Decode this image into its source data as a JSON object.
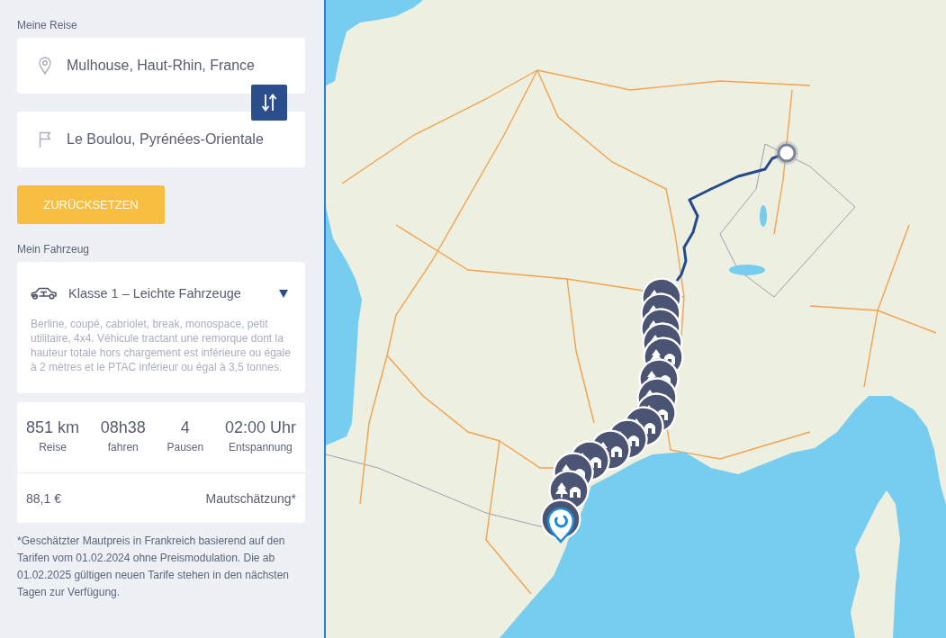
{
  "trip": {
    "heading": "Meine Reise",
    "origin": {
      "value": "Mulhouse, Haut-Rhin, France"
    },
    "destination": {
      "value": "Le Boulou, Pyrénées-Orientale"
    }
  },
  "reset_button": {
    "label": "ZURÜCKSETZEN"
  },
  "vehicle": {
    "heading": "Mein Fahrzeug",
    "class": "Klasse 1 – Leichte Fahrzeuge",
    "description": "Berline, coupé, cabriolet, break, monospace, petit utilitaire, 4x4. Véhicule tractant une remorque dont la hauteur totale hors chargement est inférieure ou égale à 2 mètres et le PTAC inférieur ou égal à 3,5 tonnes."
  },
  "summary": {
    "stats": [
      {
        "value": "851 km",
        "label": "Reise"
      },
      {
        "value": "08h38",
        "label": "fahren"
      },
      {
        "value": "4",
        "label": "Pausen"
      },
      {
        "value": "02:00 Uhr",
        "label": "Entspannung"
      }
    ],
    "toll": {
      "amount": "88,1 €",
      "label": "Mautschätzung*"
    }
  },
  "footnote": "*Geschätzter Mautpreis in Frankreich basierend auf den Tarifen vom 01.02.2024 ohne Preismodulation. Die ab 01.02.2025 gültigen neuen Tarife stehen in den nächsten Tagen zur Verfügung."
}
